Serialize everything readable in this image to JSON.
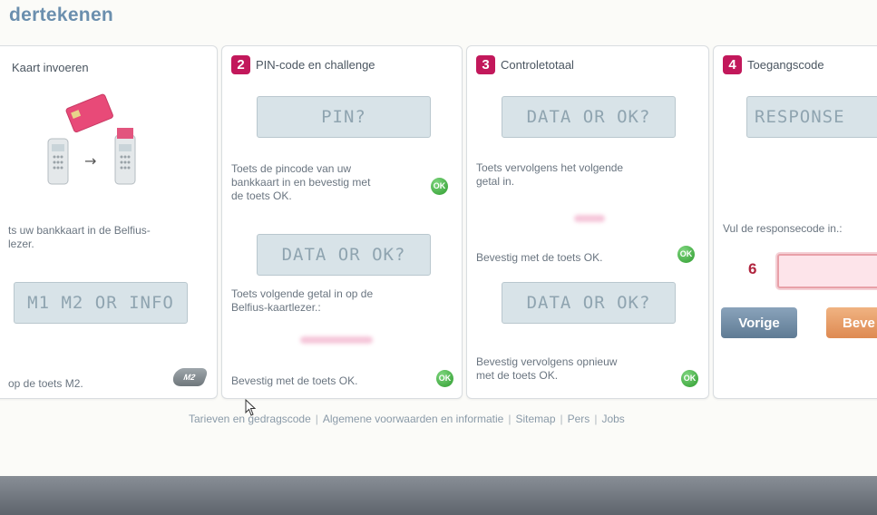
{
  "page_title": "dertekenen",
  "steps": [
    {
      "title": "Kaart invoeren",
      "lcd": "M1 M2 OR INFO",
      "text1": "ts uw bankkaart in de Belfius-\nlezer.",
      "text2": "op de toets M2.",
      "m2_icon": "M2"
    },
    {
      "number": "2",
      "title": "PIN-code en challenge",
      "lcd1": "PIN?",
      "text1": "Toets de pincode van uw\nbankkaart in en bevestig met\nde toets OK.",
      "lcd2": "DATA OR OK?",
      "text2": "Toets volgende getal in op de\nBelfius-kaartlezer.:",
      "text3": "Bevestig met de toets OK."
    },
    {
      "number": "3",
      "title": "Controletotaal",
      "lcd1": "DATA OR OK?",
      "text1": "Toets vervolgens het volgende\ngetal in.",
      "text2": "Bevestig met de toets OK.",
      "lcd2": "DATA OR OK?",
      "text3": "Bevestig vervolgens opnieuw\nmet de toets OK."
    },
    {
      "number": "4",
      "title": "Toegangscode",
      "lcd": "RESPONSE",
      "text1": "Vul de responsecode in.:",
      "marker": "6",
      "prev_label": "Vorige",
      "next_label": "Beve"
    }
  ],
  "ok_label": "OK",
  "footer_links": [
    "Tarieven en gedragscode",
    "Algemene voorwaarden en informatie",
    "Sitemap",
    "Pers",
    "Jobs"
  ],
  "colors": {
    "accent": "#c2185b",
    "title": "#6b8fae",
    "lcd": "#d8e3e8",
    "ok": "#3aa83a",
    "prev": "#6f8aa3",
    "next": "#e8a070"
  }
}
